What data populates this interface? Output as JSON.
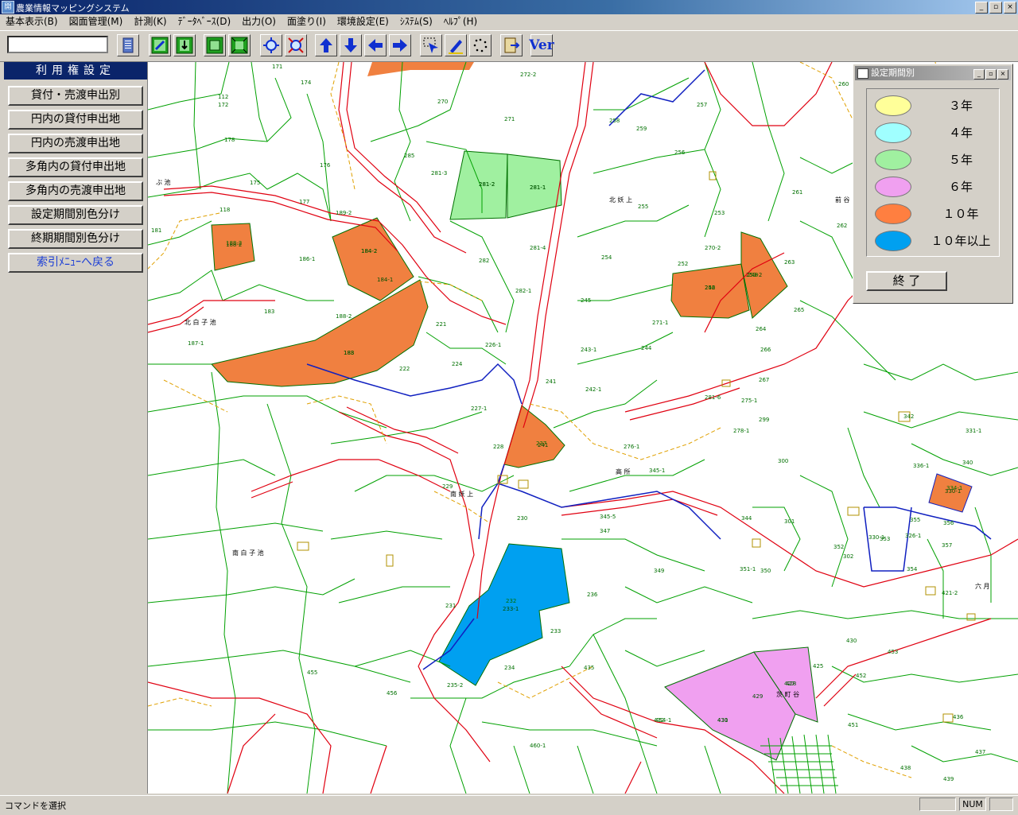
{
  "window": {
    "title": "農業情報マッピングシステム",
    "icon_glyph": "開"
  },
  "menu": [
    "基本表示(B)",
    "図面管理(M)",
    "計測(K)",
    "ﾃﾞｰﾀﾍﾞｰｽ(D)",
    "出力(O)",
    "面塗り(I)",
    "環境設定(E)",
    "ｼｽﾃﾑ(S)",
    "ﾍﾙﾌﾟ(H)"
  ],
  "toolbar": {
    "command_value": "",
    "ver_label": "Ver"
  },
  "panel": {
    "title": "利用権設定",
    "buttons": [
      "貸付・売渡申出別",
      "円内の貸付申出地",
      "円内の売渡申出地",
      "多角内の貸付申出地",
      "多角内の売渡申出地",
      "設定期間別色分け",
      "終期期間別色分け",
      "索引ﾒﾆｭｰへ戻る"
    ]
  },
  "legend": {
    "title": "設定期間別",
    "items": [
      {
        "label": "３年",
        "color": "#ffff99"
      },
      {
        "label": "４年",
        "color": "#a0ffff"
      },
      {
        "label": "５年",
        "color": "#a0f0a0"
      },
      {
        "label": "６年",
        "color": "#f0a0f0"
      },
      {
        "label": "１０年",
        "color": "#ff7f40"
      },
      {
        "label": "１０年以上",
        "color": "#00a0f0"
      }
    ],
    "close_label": "終 了"
  },
  "map": {
    "parcel_labels": [
      "112",
      "178",
      "176",
      "177",
      "118",
      "189-2",
      "188-2",
      "184-2",
      "186-1",
      "188",
      "187-1",
      "188-2",
      "183",
      "181",
      "171",
      "172",
      "174",
      "175",
      "272-2",
      "270",
      "271",
      "281-2",
      "281-1",
      "281-3",
      "285",
      "281-4",
      "282",
      "282-1",
      "221",
      "222",
      "224",
      "226-1",
      "227-1",
      "228",
      "229",
      "230",
      "231",
      "232",
      "233",
      "234",
      "235-2",
      "236",
      "237",
      "241",
      "242-1",
      "243-1",
      "244",
      "245",
      "246",
      "248",
      "252",
      "253",
      "254",
      "255",
      "256",
      "257",
      "258",
      "259",
      "260",
      "261",
      "262",
      "263",
      "264",
      "265",
      "266",
      "267",
      "270-2",
      "271-1",
      "275-1",
      "276-1",
      "278-1",
      "281-6",
      "299",
      "300",
      "301",
      "302",
      "326-1",
      "330-1",
      "331-1",
      "334-1",
      "336-1",
      "340",
      "342",
      "344",
      "345-1",
      "345-5",
      "347",
      "349",
      "350",
      "351-1",
      "352",
      "353",
      "354",
      "355",
      "356",
      "357",
      "421-2",
      "425",
      "427",
      "430",
      "431",
      "432",
      "435",
      "436",
      "437",
      "438",
      "439",
      "451",
      "452",
      "453",
      "454-1",
      "455",
      "456",
      "460-1"
    ],
    "place_names": [
      "北 妖 上",
      "南 白 子 池",
      "北 白 子 池",
      "南 妖 上",
      "高 所",
      "茨 町 谷",
      "六 月",
      "前 谷",
      "ぶ 池"
    ],
    "highlight_labels": {
      "orange": [
        "188-2",
        "184-2",
        "184-1",
        "183",
        "241",
        "252",
        "253-2",
        "330-1"
      ],
      "green": [
        "281-2",
        "281-1"
      ],
      "blue": [
        "233-1"
      ],
      "pink": [
        "428",
        "429",
        "430"
      ]
    }
  },
  "status": {
    "message": "コマンドを選択",
    "num": "NUM"
  }
}
